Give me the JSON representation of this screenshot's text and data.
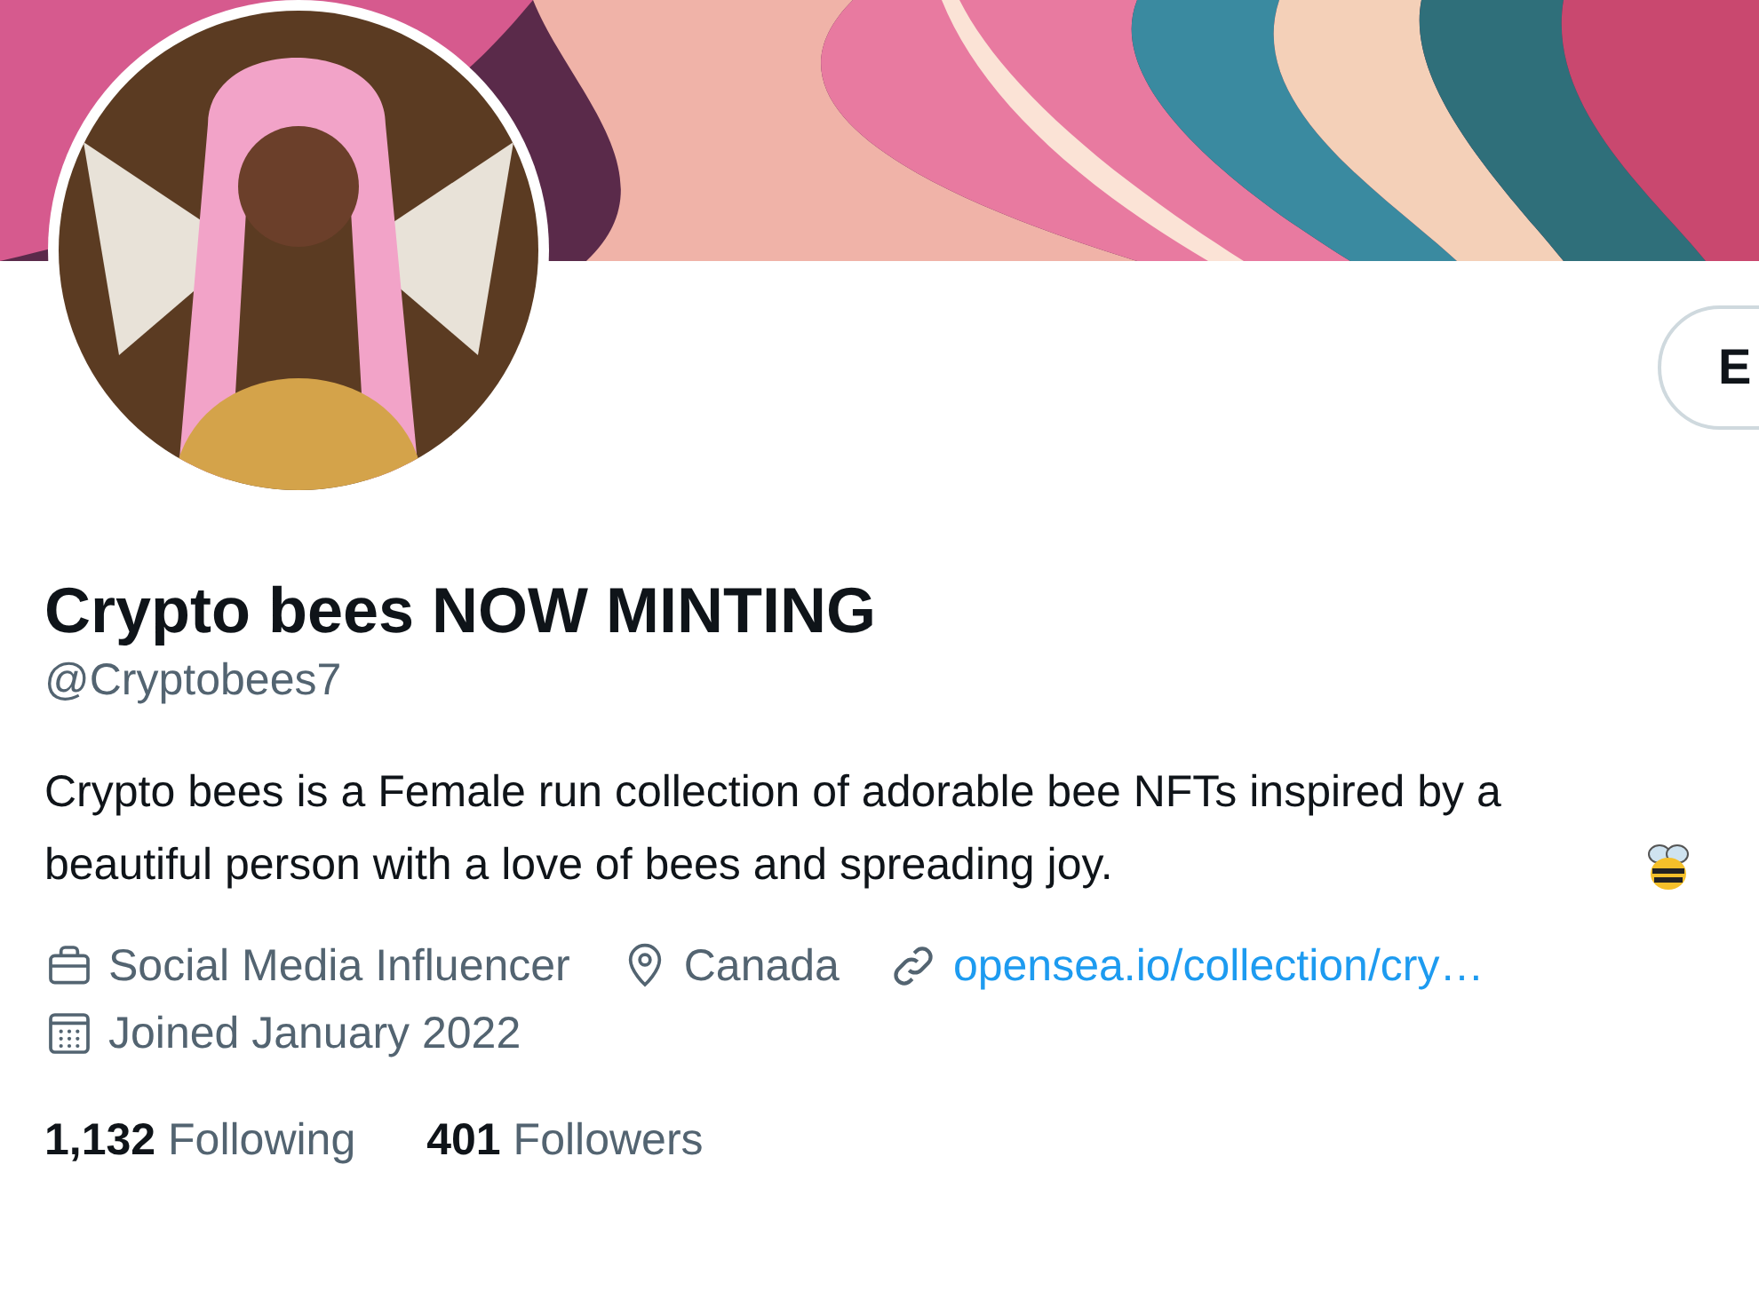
{
  "edit_button": {
    "label": "E"
  },
  "profile": {
    "name": "Crypto bees NOW MINTING",
    "handle": "@Cryptobees7",
    "bio": "Crypto bees is a Female run collection of adorable bee NFTs inspired by a beautiful person with a love of bees and spreading joy."
  },
  "meta": [
    {
      "kind": "job",
      "text": "Social Media Influencer"
    },
    {
      "kind": "location",
      "text": "Canada"
    },
    {
      "kind": "link",
      "text": "opensea.io/collection/cry…"
    },
    {
      "kind": "joined",
      "text": "Joined January 2022"
    }
  ],
  "stats": [
    {
      "count": "1,132",
      "label": "Following"
    },
    {
      "count": "401",
      "label": "Followers"
    }
  ]
}
